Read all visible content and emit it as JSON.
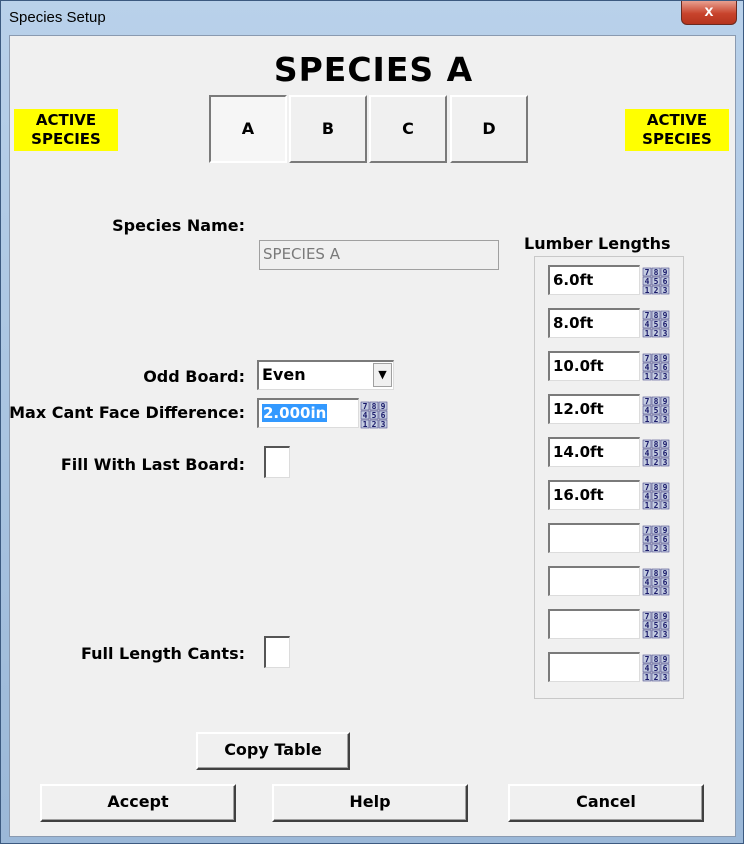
{
  "window": {
    "title": "Species Setup",
    "close_label": "x"
  },
  "heading": "SPECIES A",
  "active_badges": {
    "left": [
      "ACTIVE",
      "SPECIES"
    ],
    "right": [
      "ACTIVE",
      "SPECIES"
    ]
  },
  "tabs": [
    {
      "label": "A",
      "selected": true
    },
    {
      "label": "B",
      "selected": false
    },
    {
      "label": "C",
      "selected": false
    },
    {
      "label": "D",
      "selected": false
    }
  ],
  "species_name": {
    "label": "Species Name:",
    "value": "SPECIES A"
  },
  "odd_board": {
    "label": "Odd Board:",
    "value": "Even"
  },
  "max_cant": {
    "label": "Max Cant Face Difference:",
    "value": "2.000in"
  },
  "fill_last": {
    "label": "Fill With Last Board:"
  },
  "full_length": {
    "label": "Full Length Cants:"
  },
  "lumber_lengths": {
    "title": "Lumber Lengths",
    "values": [
      "6.0ft",
      "8.0ft",
      "10.0ft",
      "12.0ft",
      "14.0ft",
      "16.0ft",
      "",
      "",
      "",
      ""
    ]
  },
  "keypad_digits": [
    "7",
    "8",
    "9",
    "4",
    "5",
    "6",
    "1",
    "2",
    "3"
  ],
  "buttons": {
    "copy_table": "Copy Table",
    "accept": "Accept",
    "help": "Help",
    "cancel": "Cancel"
  },
  "colors": {
    "badge": "#ffff00",
    "selection": "#3399ff"
  }
}
